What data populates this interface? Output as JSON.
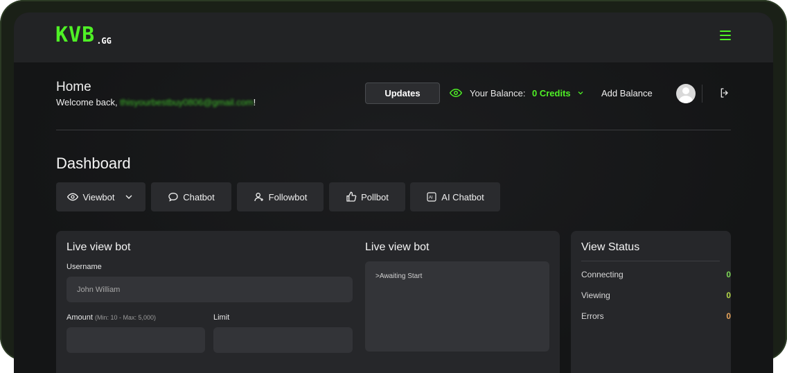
{
  "brand": {
    "logo_main": "KVB",
    "logo_sub": ".GG"
  },
  "header": {
    "title": "Home",
    "welcome_prefix": "Welcome back, ",
    "welcome_email": "thisyourbestbuy0806@gmail.com",
    "welcome_suffix": "!",
    "updates_label": "Updates",
    "balance_label": "Your Balance:",
    "balance_value": "0 Credits",
    "add_balance_label": "Add Balance"
  },
  "dashboard": {
    "title": "Dashboard",
    "tabs": [
      {
        "label": "Viewbot",
        "icon": "eye-icon"
      },
      {
        "label": "Chatbot",
        "icon": "chat-icon"
      },
      {
        "label": "Followbot",
        "icon": "user-plus-icon"
      },
      {
        "label": "Pollbot",
        "icon": "thumbs-up-icon"
      },
      {
        "label": "AI Chatbot",
        "icon": "ai-icon"
      }
    ]
  },
  "live_form": {
    "title": "Live view bot",
    "username_label": "Username",
    "username_value": "John William",
    "amount_label": "Amount",
    "amount_hint": "(Min: 10 - Max: 5,000)",
    "limit_label": "Limit"
  },
  "console": {
    "title": "Live view bot",
    "text": ">Awaiting Start"
  },
  "status": {
    "title": "View Status",
    "rows": [
      {
        "label": "Connecting",
        "value": "0",
        "color": "#7ed957"
      },
      {
        "label": "Viewing",
        "value": "0",
        "color": "#b5d948"
      },
      {
        "label": "Errors",
        "value": "0",
        "color": "#e8a45a"
      }
    ]
  },
  "colors": {
    "accent": "#4ff026",
    "panel": "#26272a",
    "background": "#141516"
  }
}
